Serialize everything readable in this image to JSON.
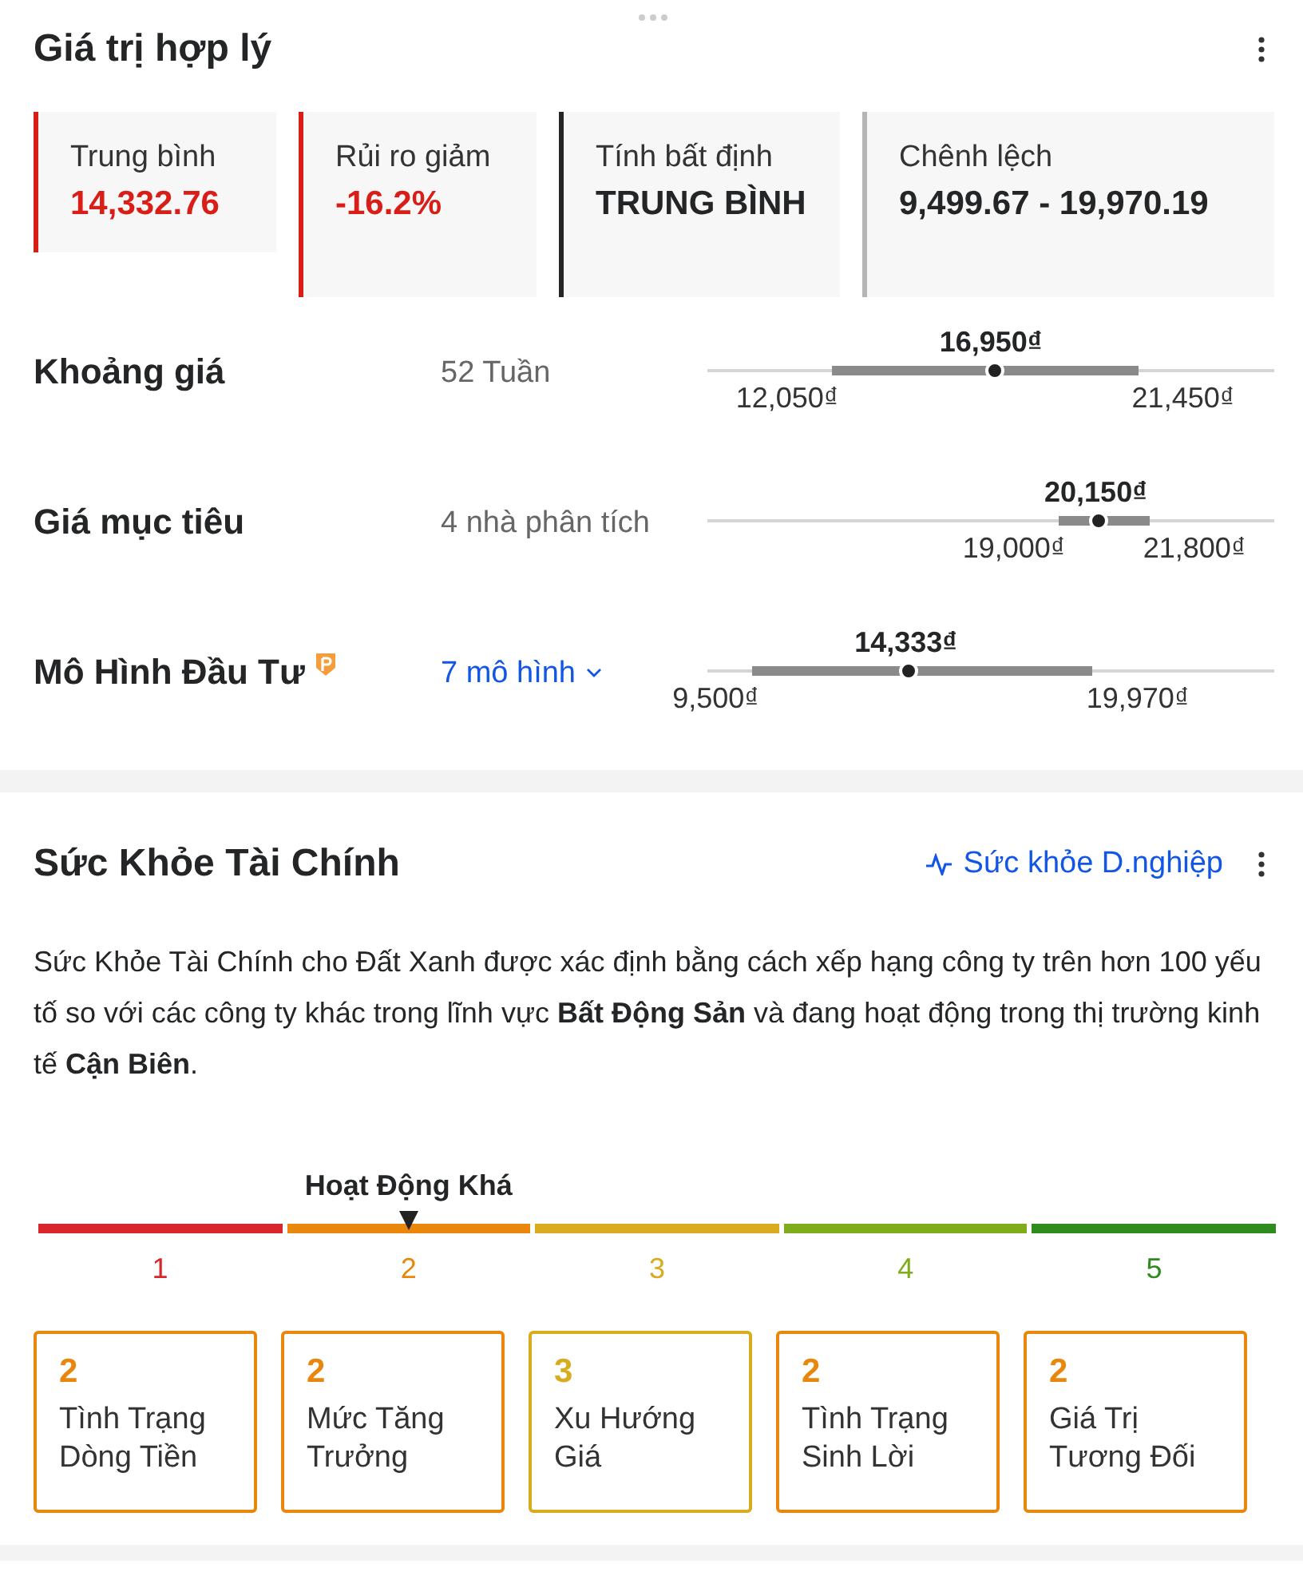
{
  "fair_value": {
    "title": "Giá trị hợp lý",
    "stats": [
      {
        "label": "Trung bình",
        "value": "14,332.76",
        "color": "#d91e18"
      },
      {
        "label": "Rủi ro giảm",
        "value": "-16.2%",
        "color": "#d91e18"
      },
      {
        "label": "Tính bất định",
        "value": "TRUNG BÌNH",
        "color": "#232526"
      },
      {
        "label": "Chênh lệch",
        "value": "9,499.67 - 19,970.19",
        "color": "#b5b5b5"
      }
    ],
    "ranges": [
      {
        "label": "Khoảng giá",
        "sub": "52 Tuần",
        "kind": "text",
        "current": {
          "label": "16,950₫",
          "level": 0.5
        },
        "low": {
          "label": "12,050₫"
        },
        "high": {
          "label": "21,450₫"
        }
      },
      {
        "label": "Giá mục tiêu",
        "sub": "4 nhà phân tích",
        "kind": "text",
        "current": {
          "label": "20,150₫",
          "level": 0.685
        },
        "low": {
          "label": "19,000₫"
        },
        "high": {
          "label": "21,800₫"
        }
      },
      {
        "label": "Mô Hình Đầu Tư",
        "sub": "7 mô hình",
        "kind": "link",
        "current": {
          "label": "14,333₫",
          "level": 0.35
        },
        "low": {
          "label": "9,500₫"
        },
        "high": {
          "label": "19,970₫"
        }
      }
    ]
  },
  "financial_health": {
    "title": "Sức Khỏe Tài Chính",
    "link": "Sức khỏe D.nghiệp",
    "description": "Sức Khỏe Tài Chính cho Đất Xanh được xác định bằng cách xếp hạng công ty trên hơn 100 yếu tố so với các công ty khác trong lĩnh vực **Bất Động Sản** và đang hoạt động trong thị trường kinh tế **Cận Biên**.",
    "rating": {
      "label": "Hoạt Động Khá"
    },
    "scale": [
      {
        "label": "1",
        "color": "#d9262a",
        "selected": false
      },
      {
        "label": "2",
        "color": "#e8870c",
        "selected": true
      },
      {
        "label": "3",
        "color": "#d9ab1e",
        "selected": false
      },
      {
        "label": "4",
        "color": "#80ac1c",
        "selected": false
      },
      {
        "label": "5",
        "color": "#2e8b1e",
        "selected": false
      }
    ],
    "cards": [
      {
        "score": "2",
        "label": "Tình Trạng Dòng Tiền",
        "color": "#e8870c"
      },
      {
        "score": "2",
        "label": "Mức Tăng Trưởng",
        "color": "#e8870c"
      },
      {
        "score": "3",
        "label": "Xu Hướng Giá",
        "color": "#d9ab1e"
      },
      {
        "score": "2",
        "label": "Tình Trạng Sinh Lời",
        "color": "#e8870c"
      },
      {
        "score": "2",
        "label": "Giá Trị Tương Đối",
        "color": "#e8870c"
      }
    ]
  }
}
